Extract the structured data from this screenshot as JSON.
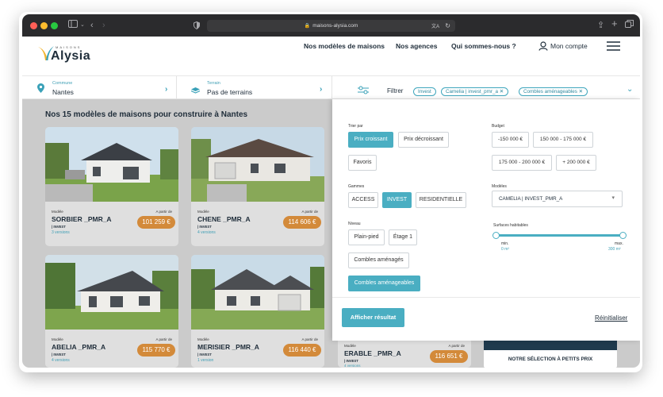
{
  "browser": {
    "url": "maisons-alysia.com"
  },
  "site": {
    "logo_small": "MAISONS",
    "logo": "Alysia",
    "nav": [
      "Nos modèles de maisons",
      "Nos agences",
      "Qui sommes-nous ?",
      "Mon compte"
    ]
  },
  "search": {
    "commune_label": "Commune",
    "commune_value": "Nantes",
    "terrain_label": "Terrain",
    "terrain_value": "Pas de terrains",
    "filter_label": "Filtrer",
    "chips": [
      "Invest",
      "Camelia | invest_pmr_a",
      "Combles aménageables"
    ]
  },
  "results": {
    "title": "Nos 15 modèles de maisons pour construire à Nantes",
    "model_label": "Modèle",
    "from_label": "A partir de",
    "invest_label": "| INVEST",
    "cards": [
      {
        "name": "SORBIER _PMR_A",
        "price": "101 259 €",
        "versions": "3 versions"
      },
      {
        "name": "CHENE _PMR_A",
        "price": "114 606 €",
        "versions": "4 versions"
      },
      {
        "name": "ABELIA _PMR_A",
        "price": "115 770 €",
        "versions": "4 versions"
      },
      {
        "name": "MERISIER _PMR_A",
        "price": "116 440 €",
        "versions": "1 version"
      },
      {
        "name": "ERABLE _PMR_A",
        "price": "116 651 €",
        "versions": "4 versions"
      }
    ],
    "promo": "NOTRE SÉLECTION À PETITS PRIX"
  },
  "filters": {
    "sort_label": "Trier par",
    "sort_options": [
      "Prix croissant",
      "Prix décroissant",
      "Favoris"
    ],
    "budget_label": "Budget",
    "budget_options": [
      "-150 000 €",
      "150 000 - 175 000 €",
      "175 000 - 200 000 €",
      "+ 200 000 €"
    ],
    "gammes_label": "Gammes",
    "gammes_options": [
      "ACCESS",
      "INVEST",
      "RESIDENTIELLE"
    ],
    "modeles_label": "Modèles",
    "modeles_value": "CAMELIA | INVEST_PMR_A",
    "niveau_label": "Niveau",
    "niveau_options": [
      "Plain-pied",
      "Étage 1",
      "Combles aménagés",
      "Combles aménageables"
    ],
    "surfaces_label": "Surfaces habitables",
    "surface_min_label": "min.",
    "surface_min_value": "0 m²",
    "surface_max_label": "max.",
    "surface_max_value": "300 m²",
    "show_button": "Afficher résultat",
    "reset_link": "Réinitialiser"
  },
  "colors": {
    "accent": "#4aaec2",
    "price": "#d38a3a",
    "dark": "#1f2d3a",
    "logo_yellow": "#f2b531",
    "logo_teal": "#3aa1b8"
  }
}
